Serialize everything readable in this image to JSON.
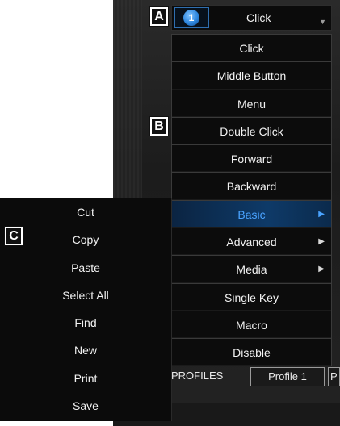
{
  "callouts": {
    "a": "A",
    "b": "B",
    "c": "C"
  },
  "header": {
    "number": "1",
    "label": "Click"
  },
  "button_menu": {
    "items": [
      {
        "label": "Click"
      },
      {
        "label": "Middle Button"
      },
      {
        "label": "Menu"
      },
      {
        "label": "Double Click"
      },
      {
        "label": "Forward"
      },
      {
        "label": "Backward"
      },
      {
        "label": "Basic",
        "submenu": true,
        "active": true
      },
      {
        "label": "Advanced",
        "submenu": true
      },
      {
        "label": "Media",
        "submenu": true
      },
      {
        "label": "Single Key"
      },
      {
        "label": "Macro"
      },
      {
        "label": "Disable"
      }
    ]
  },
  "basic_submenu": {
    "items": [
      {
        "label": "Cut"
      },
      {
        "label": "Copy"
      },
      {
        "label": "Paste"
      },
      {
        "label": "Select All"
      },
      {
        "label": "Find"
      },
      {
        "label": "New"
      },
      {
        "label": "Print"
      },
      {
        "label": "Save"
      }
    ]
  },
  "profiles": {
    "label": "PROFILES",
    "active_tab": "Profile 1",
    "next_tab": "P"
  },
  "colors": {
    "accent": "#4aa3ff",
    "active_bg": "#0e3a68",
    "menu_bg": "#0c0c0c"
  },
  "icons": {
    "submenu_arrow": "triangle-right-icon",
    "dropdown_arrow": "triangle-down-icon"
  }
}
